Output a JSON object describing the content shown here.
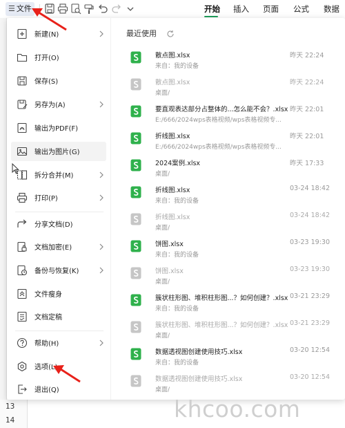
{
  "toolbar": {
    "file_label": "文件",
    "menu_glyph": "☰",
    "tabs": [
      {
        "label": "开始",
        "active": true
      },
      {
        "label": "插入",
        "active": false
      },
      {
        "label": "页面",
        "active": false
      },
      {
        "label": "公式",
        "active": false
      },
      {
        "label": "数据",
        "active": false
      }
    ],
    "quick_access_icons": [
      "save-icon",
      "print-icon",
      "print-preview-icon",
      "format-painter-icon",
      "undo-icon",
      "redo-icon",
      "dropdown-icon"
    ]
  },
  "file_menu": {
    "items": [
      {
        "label": "新建(N)",
        "icon": "new-icon",
        "has_submenu": true
      },
      {
        "label": "打开(O)",
        "icon": "open-folder-icon",
        "has_submenu": false
      },
      {
        "label": "保存(S)",
        "icon": "save-icon",
        "has_submenu": false
      },
      {
        "label": "另存为(A)",
        "icon": "save-as-icon",
        "has_submenu": true
      },
      {
        "label": "输出为PDF(F)",
        "icon": "pdf-icon",
        "has_submenu": false
      },
      {
        "label": "输出为图片(G)",
        "icon": "image-icon",
        "has_submenu": false
      },
      {
        "label": "拆分合并(M)",
        "icon": "split-merge-icon",
        "has_submenu": true
      },
      {
        "label": "打印(P)",
        "icon": "print-icon",
        "has_submenu": true
      },
      {
        "label": "分享文档(D)",
        "icon": "share-icon",
        "has_submenu": false
      },
      {
        "label": "文档加密(E)",
        "icon": "lock-icon",
        "has_submenu": true
      },
      {
        "label": "备份与恢复(K)",
        "icon": "backup-icon",
        "has_submenu": true
      },
      {
        "label": "文件瘦身",
        "icon": "slim-icon",
        "has_submenu": false
      },
      {
        "label": "文档定稿",
        "icon": "finalize-icon",
        "has_submenu": false
      },
      {
        "label": "帮助(H)",
        "icon": "help-icon",
        "has_submenu": true
      },
      {
        "label": "选项(L)",
        "icon": "settings-icon",
        "has_submenu": false
      },
      {
        "label": "退出(Q)",
        "icon": "exit-icon",
        "has_submenu": false
      }
    ]
  },
  "recent": {
    "title": "最近使用",
    "files": [
      {
        "name": "散点图.xlsx",
        "path": "来自：我的设备",
        "time": "昨天 22:24",
        "dim": false
      },
      {
        "name": "散点图.xlsx",
        "path": "桌面/",
        "time": "昨天 22:24",
        "dim": true
      },
      {
        "name": "要直观表达部分占整体的...怎么能不会？.xlsx",
        "path": "E:/666/2024wps表格视频/wps表格视频专...",
        "time": "昨天 22:01",
        "dim": false
      },
      {
        "name": "折线图.xlsx",
        "path": "E:/666/2024wps表格视频/wps表格视频专...",
        "time": "昨天 22:01",
        "dim": false
      },
      {
        "name": "2024案例.xlsx",
        "path": "桌面/",
        "time": "昨天 17:33",
        "dim": false
      },
      {
        "name": "折线图.xlsx",
        "path": "来自：我的设备",
        "time": "03-24 18:42",
        "dim": false
      },
      {
        "name": "折线图.xlsx",
        "path": "桌面/",
        "time": "03-24 18:42",
        "dim": true
      },
      {
        "name": "饼图.xlsx",
        "path": "来自：我的设备",
        "time": "03-23 19:30",
        "dim": false
      },
      {
        "name": "饼图.xlsx",
        "path": "桌面/",
        "time": "03-23 19:30",
        "dim": true
      },
      {
        "name": "簇状柱形图、堆积柱形图...？如何创建？.xlsx",
        "path": "来自：我的设备",
        "time": "03-21 23:29",
        "dim": false
      },
      {
        "name": "簇状柱形图、堆积柱形图...？如何创建？.xlsx",
        "path": "桌面/",
        "time": "03-21 23:29",
        "dim": true
      },
      {
        "name": "数据透视图创建使用技巧.xlsx",
        "path": "来自：我的设备",
        "time": "03-20 12:54",
        "dim": false
      },
      {
        "name": "数据透视图创建使用技巧.xlsx",
        "path": "桌面/",
        "time": "03-20 12:54",
        "dim": true
      }
    ]
  },
  "sheet": {
    "row_numbers": [
      "13",
      "14"
    ]
  },
  "watermark": "khcoo.com",
  "colors": {
    "accent": "#1e9d5a",
    "annotation_arrow": "#e8211a",
    "file_icon_green": "#2fb14c",
    "file_icon_dim": "#c6c6c6"
  }
}
